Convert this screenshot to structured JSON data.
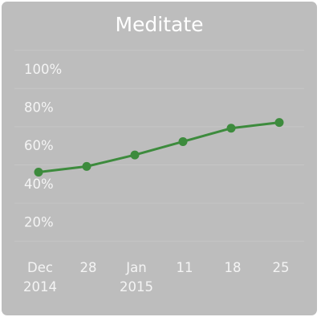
{
  "widget": {
    "title": "Meditate"
  },
  "colors": {
    "card_background": "#bdbdbd",
    "line": "#3d8b3d",
    "grid": "#c6c6c6",
    "text": "#ffffff"
  },
  "chart_data": {
    "type": "line",
    "title": "Meditate",
    "xlabel": "",
    "ylabel": "",
    "ylim": [
      0,
      100
    ],
    "grid": true,
    "y_ticks": [
      {
        "value": 100,
        "label": "100%"
      },
      {
        "value": 80,
        "label": "80%"
      },
      {
        "value": 60,
        "label": "60%"
      },
      {
        "value": 40,
        "label": "40%"
      },
      {
        "value": 20,
        "label": "20%"
      }
    ],
    "x_ticks": [
      {
        "line1": "Dec",
        "line2": "2014"
      },
      {
        "line1": "28",
        "line2": ""
      },
      {
        "line1": "Jan",
        "line2": "2015"
      },
      {
        "line1": "11",
        "line2": ""
      },
      {
        "line1": "18",
        "line2": ""
      },
      {
        "line1": "25",
        "line2": ""
      }
    ],
    "series": [
      {
        "values": [
          46,
          49,
          55,
          62,
          69,
          72
        ]
      }
    ]
  }
}
